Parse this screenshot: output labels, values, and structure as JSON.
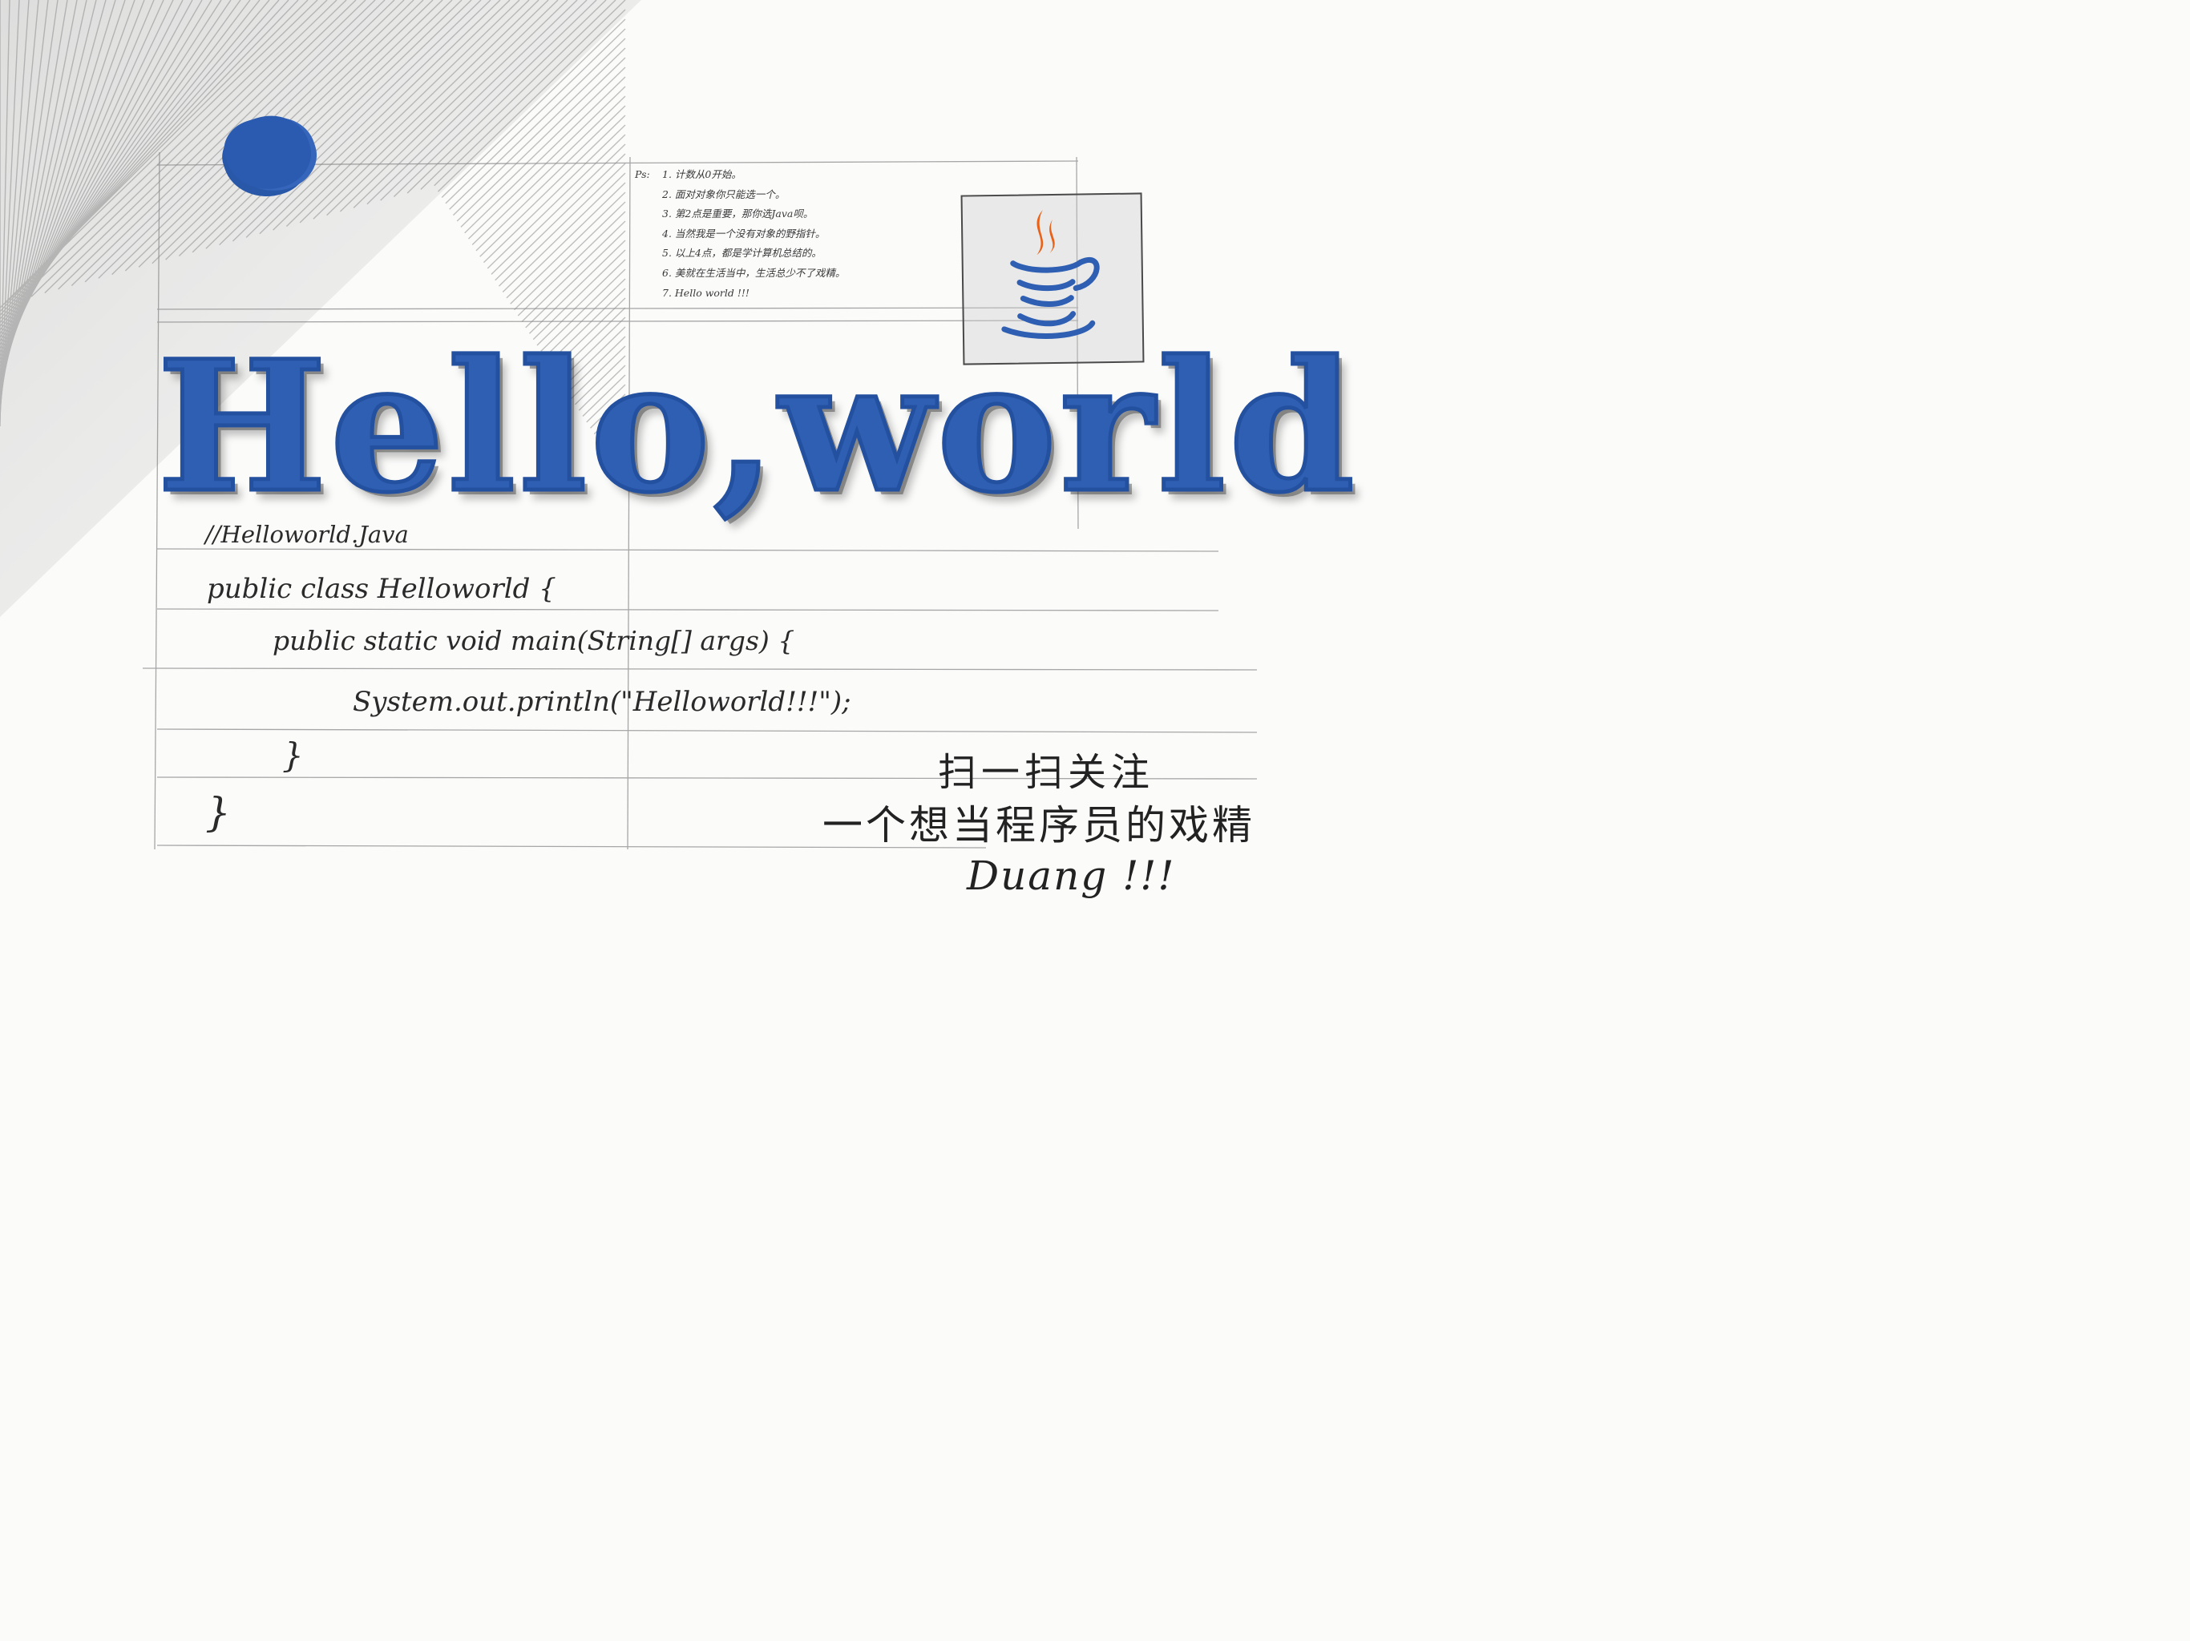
{
  "colors": {
    "accent_blue": "#2e5fb3",
    "ink": "#2a2a2a",
    "java_orange": "#e8621a"
  },
  "icon": "java-coffee-cup-icon",
  "ps_notes": {
    "label": "Ps:",
    "items": [
      "1. 计数从0开始。",
      "2. 面对对象你只能选一个。",
      "3. 第2点是重要，那你选Java呗。",
      "4. 当然我是一个没有对象的野指针。",
      "5. 以上4点，都是学计算机总结的。",
      "6. 美就在生活当中，生活总少不了戏精。",
      "7. Hello world !!!"
    ]
  },
  "title": "Hello,world",
  "code": {
    "comment": "//Helloworld.Java",
    "class_decl": "public class Helloworld {",
    "main_decl": "public static void main(String[] args) {",
    "print_stmt": "System.out.println(\"Helloworld!!!\");",
    "close_inner": "}",
    "close_outer": "}"
  },
  "promo": {
    "line1": "扫一扫关注",
    "line2": "一个想当程序员的戏精",
    "line3": "Duang !!!"
  }
}
